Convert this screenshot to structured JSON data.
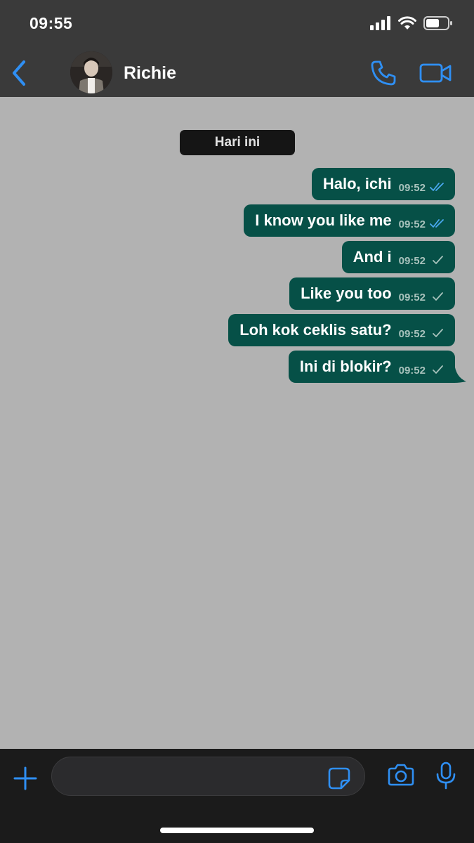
{
  "status": {
    "time": "09:55"
  },
  "header": {
    "contact_name": "Richie"
  },
  "chat": {
    "date_label": "Hari ini",
    "messages": [
      {
        "text": "Halo, ichi",
        "time": "09:52",
        "status": "read"
      },
      {
        "text": "I know you like me",
        "time": "09:52",
        "status": "read"
      },
      {
        "text": "And i",
        "time": "09:52",
        "status": "sent"
      },
      {
        "text": "Like you too",
        "time": "09:52",
        "status": "sent"
      },
      {
        "text": "Loh kok ceklis satu?",
        "time": "09:52",
        "status": "sent"
      },
      {
        "text": "Ini di blokir?",
        "time": "09:52",
        "status": "sent"
      }
    ]
  },
  "composer": {
    "input_value": ""
  },
  "colors": {
    "accent": "#2f8ff3",
    "bubble": "#065047",
    "background": "#b2b2b2",
    "read_tick": "#4aa8f0",
    "sent_tick": "#a8c2bc"
  },
  "icons": {
    "back": "chevron-left-icon",
    "call": "phone-icon",
    "video": "video-camera-icon",
    "plus": "plus-icon",
    "sticker": "sticker-icon",
    "camera": "camera-icon",
    "mic": "microphone-icon"
  }
}
